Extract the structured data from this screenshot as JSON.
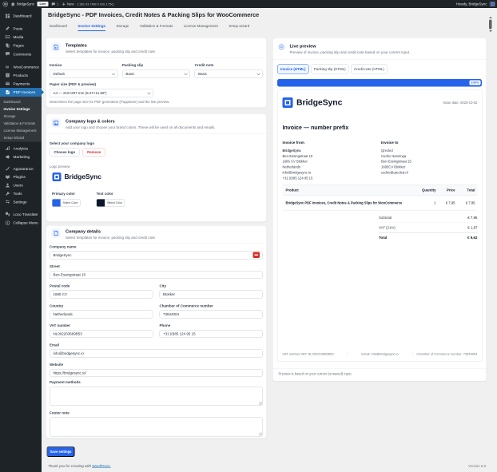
{
  "admin_bar": {
    "wp_logo": "W",
    "site_name": "BridgeSync",
    "env_badge": "Live",
    "comments_count": "1",
    "new_label": "New",
    "qm_stats": "1.38s 93.7MB 0.09s 175Q",
    "howdy": "Howdy, BridgeSync"
  },
  "sidebar": {
    "items": [
      "Dashboard",
      "Posts",
      "Media",
      "Pages",
      "Comments",
      "WooCommerce",
      "Products",
      "Payments",
      "PDF Invoices",
      "Analytics",
      "Marketing",
      "Appearance",
      "Plugins",
      "Users",
      "Tools",
      "Settings",
      "Loco Translate",
      "Collapse Menu"
    ],
    "submenu": [
      "Dashboard",
      "Invoice Settings",
      "Storage",
      "Validation & Formats",
      "License Management",
      "Setup Wizard"
    ]
  },
  "page": {
    "title": "BridgeSync - PDF Invoices, Credit Notes & Packing Slips for WooCommerce",
    "tabs": [
      "Dashboard",
      "Invoice Settings",
      "Storage",
      "Validation & Formats",
      "License Management",
      "Setup wizard"
    ],
    "active_tab": "Invoice Settings"
  },
  "templates_card": {
    "title": "Templates",
    "subtitle": "Select templates for invoice, packing slip and credit note",
    "invoice_label": "Invoice",
    "invoice_value": "Default",
    "packing_label": "Packing slip",
    "packing_value": "Basic",
    "credit_label": "Credit note",
    "credit_value": "Basic",
    "paper_label": "Paper size (PDF & preview)",
    "paper_value": "A4 — 210×297 mm (8.27×11.69\")",
    "paper_help": "Determines the page size for PDF generation (Puppeteer) and the live preview."
  },
  "logo_card": {
    "title": "Company logo & colors",
    "subtitle": "Add your logo and choose your brand colors. These will be used on all documents and emails.",
    "select_logo_label": "Select your company logo",
    "choose_button": "Choose logo",
    "remove_button": "Remove",
    "preview_label": "Logo preview",
    "logo_text": "BridgeSync",
    "primary_label": "Primary color",
    "text_label": "Text color",
    "picker_button": "Select Color",
    "primary_hex": "#2563eb",
    "text_hex": "#0f172a"
  },
  "details_card": {
    "title": "Company details",
    "subtitle": "Select templates for invoice, packing slip and credit note",
    "fields": {
      "company": {
        "label": "Company name",
        "value": "BridgeSync"
      },
      "street": {
        "label": "Street",
        "value": "Ben-Essingstraat 15"
      },
      "postal": {
        "label": "Postal code",
        "value": "1685 CV"
      },
      "city": {
        "label": "City",
        "value": "Blokker"
      },
      "country": {
        "label": "Country",
        "value": "Netherlands"
      },
      "coc": {
        "label": "Chamber of Commerce number",
        "value": "73844004"
      },
      "vat": {
        "label": "VAT number",
        "value": "NL002203669B53"
      },
      "phone": {
        "label": "Phone",
        "value": "+31 (0)85 124 95 15"
      },
      "email": {
        "label": "Email",
        "value": "info@bridgesync.io"
      },
      "website": {
        "label": "Website",
        "value": "https://bridgesync.io/"
      },
      "payment": {
        "label": "Payment methods",
        "value": ""
      },
      "footer_note": {
        "label": "Footer note",
        "value": ""
      }
    }
  },
  "preview_card": {
    "title": "Live preview",
    "subtitle": "Preview of invoice, packing slip and credit note based on your current input.",
    "tabs": [
      "Invoice (HTML)",
      "Packing slip (HTML)",
      "Credit note (HTML)"
    ],
    "active_tab": "Invoice (HTML)",
    "zoom": "100%",
    "note": "Preview is based on your current (unsaved) input."
  },
  "invoice": {
    "logo_text": "BridgeSync",
    "issue_date": "Issue date: 2025-10-02",
    "doc_title": "Invoice — number prefix",
    "from_label": "Invoice from",
    "to_label": "Invoice to",
    "from_lines": [
      "BridgeSync",
      "Ben-Essingstraat 15",
      "1685 CV Blokker",
      "Netherlands",
      "info@bridgesync.io",
      "+31 (0)85 124 95 15"
    ],
    "to_lines": [
      "Qrecled",
      "Cedric Nanninga",
      "Ben-Essingstraat 15",
      "1695CV Blokker",
      "cedric@qrecled.nl"
    ],
    "table": {
      "headers": [
        "Product",
        "Quantity",
        "Price",
        "Total"
      ],
      "row": {
        "product": "BridgeSync PDF Invoices, Credit Notes & Packing Slips for WooCommerce",
        "quantity": "1",
        "price": "€ 7,95",
        "total": "€ 7,95"
      }
    },
    "totals": [
      {
        "label": "Subtotal",
        "value": "€ 7,95"
      },
      {
        "label": "VAT (21%)",
        "value": "€ 1,67"
      },
      {
        "label": "Total",
        "value": "€ 9,62"
      }
    ],
    "footer": {
      "vat": "VAT number VAT: NL002203669B53",
      "email": "Email: info@bridgesync.io",
      "coc": "Chamber of Commerce number: 73844004"
    }
  },
  "actions": {
    "save_button": "Save settings"
  },
  "footer": {
    "thanks_prefix": "Thank you for creating with ",
    "thanks_link": "WordPress.",
    "version": "Version 6.9"
  },
  "colors": {
    "accent_blue": "#2563eb",
    "wp_admin_dark": "#1d2327",
    "wp_active_blue": "#2271b1",
    "danger_red": "#dc2626"
  }
}
